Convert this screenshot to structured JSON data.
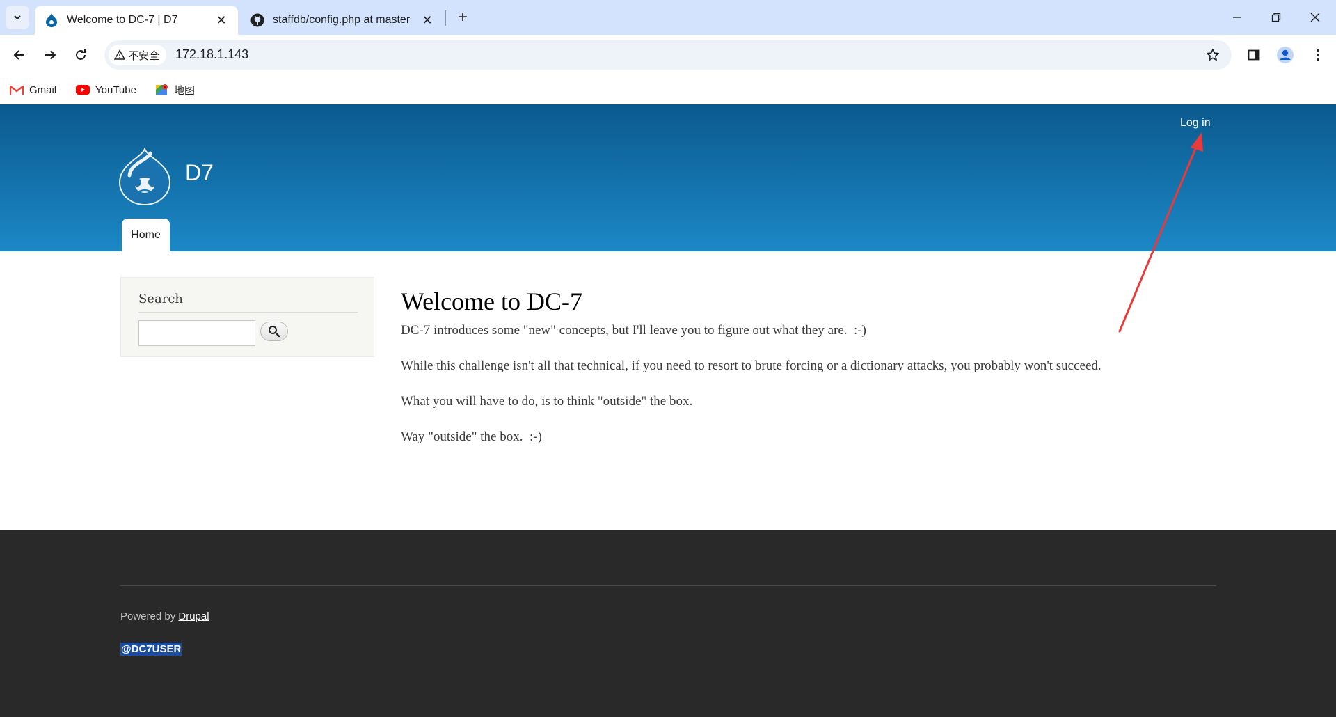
{
  "browser": {
    "tabs": [
      {
        "title": "Welcome to DC-7 | D7",
        "active": true,
        "icon": "drupal-icon"
      },
      {
        "title": "staffdb/config.php at master",
        "active": false,
        "icon": "github-icon"
      }
    ],
    "close_glyph": "✕",
    "new_tab_glyph": "+",
    "address": {
      "security_label": "不安全",
      "url": "172.18.1.143"
    },
    "bookmarks": [
      {
        "label": "Gmail",
        "icon": "gmail-icon"
      },
      {
        "label": "YouTube",
        "icon": "youtube-icon"
      },
      {
        "label": "地图",
        "icon": "maps-icon"
      }
    ]
  },
  "site": {
    "name": "D7",
    "login_label": "Log in",
    "nav": {
      "home_label": "Home"
    },
    "colors": {
      "header_top": "#0b5a8e",
      "header_bottom": "#1b88c6",
      "footer": "#292929"
    }
  },
  "sidebar": {
    "search_title": "Search",
    "search_value": ""
  },
  "main": {
    "title": "Welcome to DC-7",
    "paragraphs": [
      "DC-7 introduces some \"new\" concepts, but I'll leave you to figure out what they are.  :-)",
      "While this challenge isn't all that technical, if you need to resort to brute forcing or a dictionary attacks, you probably won't succeed.",
      "What you will have to do, is to think \"outside\" the box.",
      "Way \"outside\" the box.  :-)"
    ]
  },
  "footer": {
    "powered_prefix": "Powered by",
    "powered_link": "Drupal",
    "credit": "@DC7USER"
  },
  "annotation": {
    "type": "arrow",
    "color": "#e83a3a",
    "points_to": "login-link"
  }
}
